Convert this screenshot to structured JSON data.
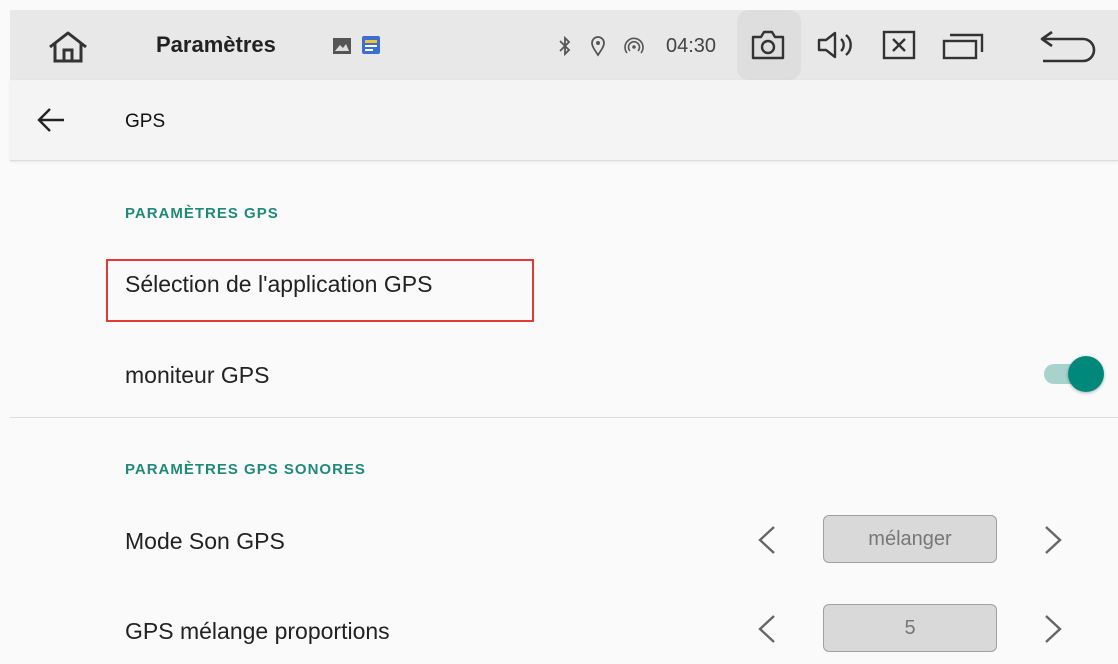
{
  "status_bar": {
    "title": "Paramètres",
    "time": "04:30",
    "icons": [
      "home-icon",
      "image-icon",
      "app-notification-icon",
      "bluetooth-icon",
      "location-icon",
      "hotspot-icon",
      "camera-icon",
      "volume-icon",
      "close-window-icon",
      "recent-apps-icon",
      "back-icon"
    ]
  },
  "app_bar": {
    "title": "GPS"
  },
  "sections": {
    "gps_settings": {
      "header": "PARAMÈTRES GPS",
      "app_selection_label": "Sélection de l'application GPS",
      "monitor_label": "moniteur GPS",
      "monitor_on": true
    },
    "gps_sound": {
      "header": "PARAMÈTRES GPS SONORES",
      "mode_label": "Mode Son GPS",
      "mode_value": "mélanger",
      "mix_label": "GPS mélange proportions",
      "mix_value": "5"
    }
  },
  "colors": {
    "accent": "#00897b",
    "section_header": "#1f8a7a",
    "highlight": "#e53935"
  }
}
